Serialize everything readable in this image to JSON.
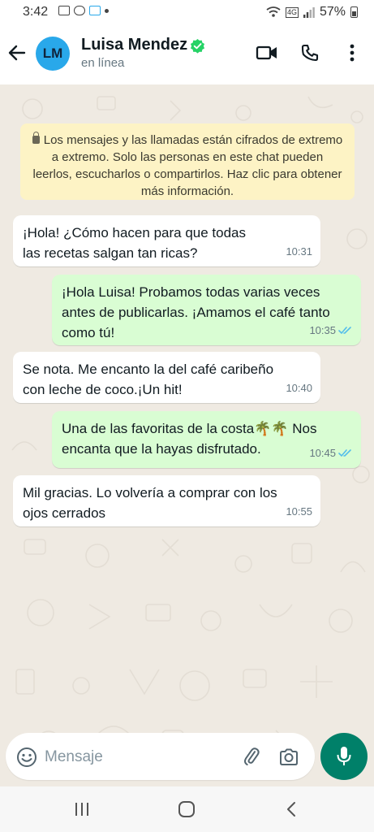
{
  "status_bar": {
    "time": "3:42",
    "battery": "57%"
  },
  "header": {
    "contact_name": "Luisa Mendez",
    "avatar_initials": "LM",
    "status": "en línea",
    "icons": [
      "back-arrow-icon",
      "verified-badge-icon",
      "video-call-icon",
      "phone-icon",
      "more-vert-icon"
    ]
  },
  "colors": {
    "header_bg": "#ffffff",
    "chat_bg": "#efeae2",
    "incoming_bubble": "#ffffff",
    "outgoing_bubble": "#d9fdd3",
    "notice_bg": "#fdf3c5",
    "accent": "#008069",
    "avatar": "#29a8ea",
    "read_ticks": "#53bdeb"
  },
  "encryption_notice": "Los mensajes y las llamadas están cifrados de extremo a extremo. Solo las personas en este chat pueden leerlos, escucharlos o compartirlos. Haz clic para obtener más información.",
  "messages": [
    {
      "direction": "incoming",
      "text": "¡Hola! ¿Cómo hacen para que todas las recetas salgan tan ricas?",
      "time": "10:31"
    },
    {
      "direction": "outgoing",
      "text": "¡Hola Luisa! Probamos todas varias veces antes de publicarlas. ¡Amamos el café tanto como tú!",
      "time": "10:35",
      "read": true
    },
    {
      "direction": "incoming",
      "text": "Se nota. Me encanto la del café caribeño con leche de coco.¡Un hit!",
      "time": "10:40"
    },
    {
      "direction": "outgoing",
      "text": "Una de las favoritas de la costa🌴🌴 Nos encanta que la hayas disfrutado.",
      "time": "10:45",
      "read": true
    },
    {
      "direction": "incoming",
      "text": "Mil gracias. Lo volvería a comprar con los ojos cerrados",
      "time": "10:55"
    }
  ],
  "input": {
    "placeholder": "Mensaje",
    "value": ""
  },
  "nav_icons": [
    "recent-apps-icon",
    "home-icon",
    "nav-back-icon"
  ]
}
